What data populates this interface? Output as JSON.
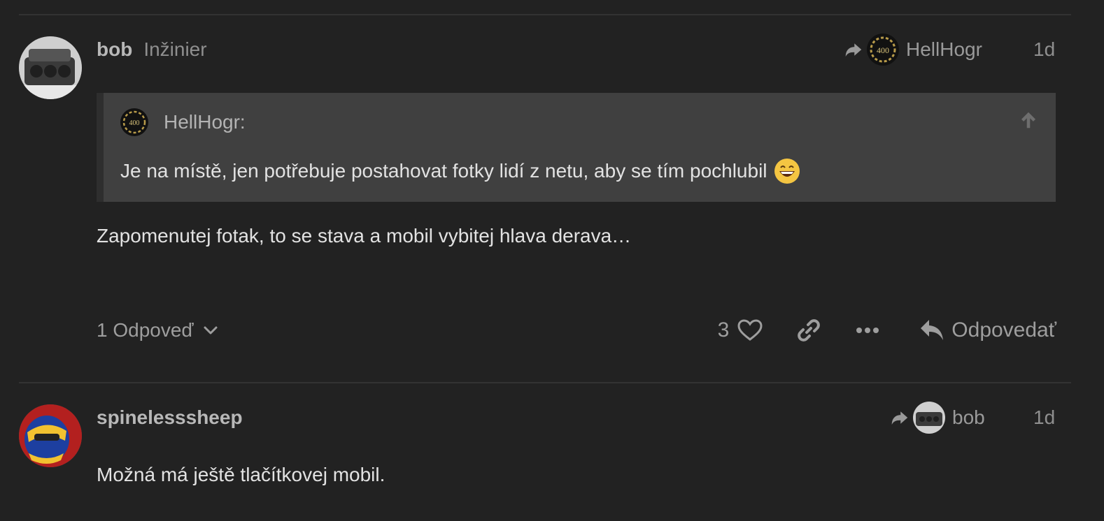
{
  "post1": {
    "username": "bob",
    "user_title": "Inžinier",
    "reply_to_user": "HellHogr",
    "date": "1d",
    "quote": {
      "author": "HellHogr:",
      "text": "Je na místě, jen potřebuje postahovat fotky lidí z netu, aby se tím pochlubil"
    },
    "text": "Zapomenutej fotak, to se stava a mobil vybitej hlava derava…",
    "replies_label": "1 Odpoveď",
    "like_count": "3",
    "reply_label": "Odpovedať",
    "icons": [
      "reply-arrow-icon",
      "arrow-up-icon",
      "chevron-down-icon",
      "heart-icon",
      "link-icon",
      "more-icon",
      "reply-icon"
    ]
  },
  "post2": {
    "username": "spinelesssheep",
    "reply_to_user": "bob",
    "date": "1d",
    "text": "Možná má ještě tlačítkovej mobil."
  },
  "colors": {
    "background": "#222222",
    "quote_background": "#404040",
    "divider": "#333333",
    "muted_text": "#9e9e9e"
  }
}
